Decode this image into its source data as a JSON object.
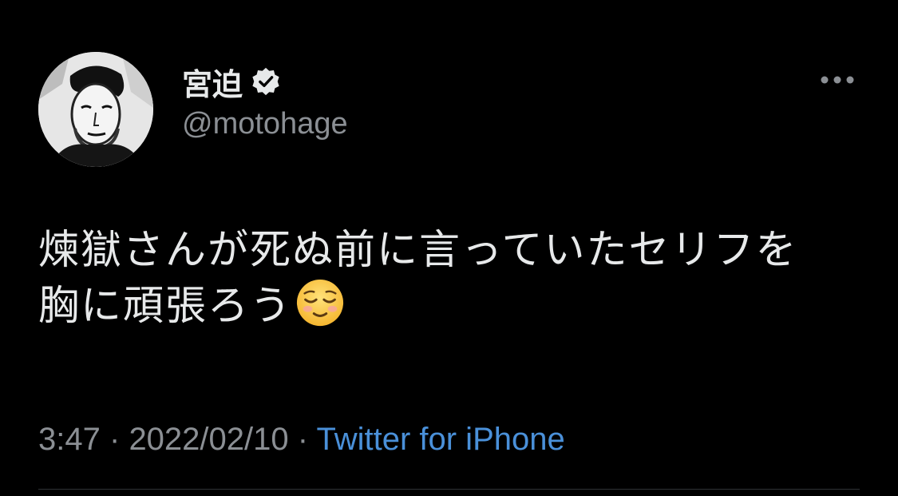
{
  "tweet": {
    "author": {
      "display_name": "宮迫",
      "handle": "@motohage",
      "verified": true,
      "avatar_icon": "avatar"
    },
    "more_icon": "more-options-icon",
    "text": "煉獄さんが死ぬ前に言っていたセリフを胸に頑張ろう",
    "emoji": "relieved-face-emoji",
    "time": "3:47",
    "separator": "·",
    "date": "2022/02/10",
    "source": "Twitter for iPhone"
  },
  "colors": {
    "background": "#000000",
    "text": "#e7e9ea",
    "secondary": "#8b8f94",
    "link": "#4a90d9",
    "divider": "#2f3336"
  }
}
